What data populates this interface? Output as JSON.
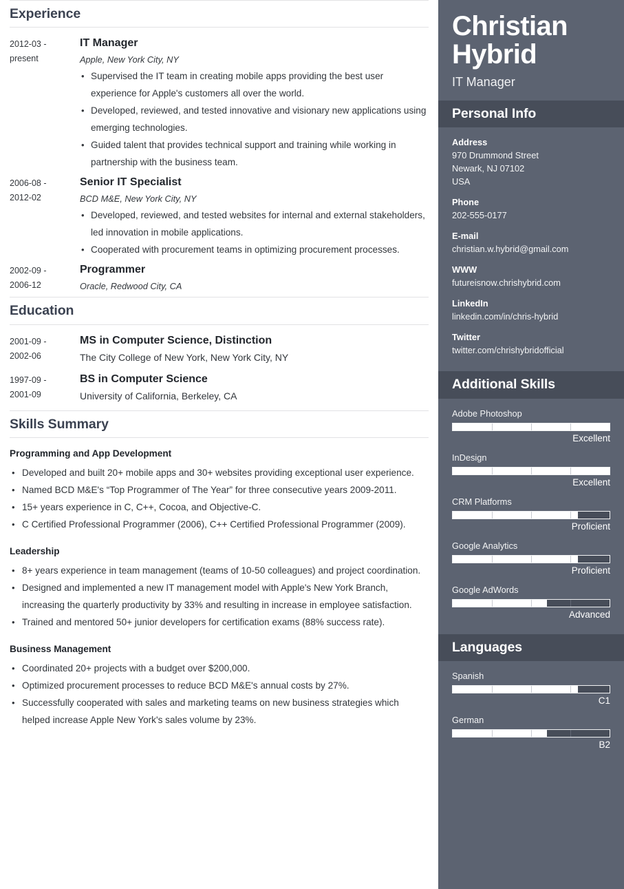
{
  "colors": {
    "sidebar_bg": "#5c6371",
    "sidebar_head_bg": "#474d59",
    "heading_text": "#3b4251",
    "body_text": "#33373c",
    "rule": "#e2e2e4"
  },
  "main": {
    "sections": [
      {
        "id": "experience",
        "title": "Experience",
        "entries": [
          {
            "dates": [
              "2012-03 -",
              "present"
            ],
            "title": "IT Manager",
            "subtitle": "Apple, New York City, NY",
            "bullets": [
              "Supervised the IT team in creating mobile apps providing the best user experience for Apple's customers all over the world.",
              "Developed, reviewed, and tested innovative and visionary new applications using emerging technologies.",
              "Guided talent that provides technical support and training while working in partnership with the business team."
            ]
          },
          {
            "dates": [
              "2006-08 -",
              "2012-02"
            ],
            "title": "Senior IT Specialist",
            "subtitle": "BCD M&E, New York City, NY",
            "bullets": [
              "Developed, reviewed, and tested websites for internal and external stakeholders, led innovation in mobile applications.",
              "Cooperated with procurement teams in optimizing procurement processes."
            ]
          },
          {
            "dates": [
              "2002-09 -",
              "2006-12"
            ],
            "title": "Programmer",
            "subtitle": "Oracle, Redwood City, CA",
            "bullets": []
          }
        ]
      },
      {
        "id": "education",
        "title": "Education",
        "entries": [
          {
            "dates": [
              "2001-09 -",
              "2002-06"
            ],
            "title": "MS in Computer Science, Distinction",
            "school": "The City College of New York, New York City, NY"
          },
          {
            "dates": [
              "1997-09 -",
              "2001-09"
            ],
            "title": "BS in Computer Science",
            "school": "University of California, Berkeley, CA"
          }
        ]
      },
      {
        "id": "skills-summary",
        "title": "Skills Summary",
        "groups": [
          {
            "heading": "Programming and App Development",
            "bullets": [
              "Developed and built 20+ mobile apps and 30+ websites providing exceptional user experience.",
              "Named BCD M&E's “Top Programmer of The Year” for three consecutive years 2009-2011.",
              "15+ years experience in C, C++, Cocoa, and Objective-C.",
              "C Certified Professional Programmer (2006), C++ Certified Professional Programmer (2009)."
            ]
          },
          {
            "heading": "Leadership",
            "bullets": [
              "8+ years experience in team management (teams of 10-50 colleagues) and project coordination.",
              "Designed and implemented a new IT management model with Apple's New York Branch, increasing the quarterly productivity by 33% and resulting in increase in employee satisfaction.",
              "Trained and mentored 50+ junior developers for certification exams (88% success rate)."
            ]
          },
          {
            "heading": "Business Management",
            "bullets": [
              "Coordinated 20+ projects with a budget over $200,000.",
              "Optimized procurement processes to reduce BCD M&E's annual costs by 27%.",
              "Successfully cooperated with sales and marketing teams on new business strategies which helped increase Apple New York's sales volume by 23%."
            ]
          }
        ]
      }
    ]
  },
  "sidebar": {
    "name_line1": "Christian",
    "name_line2": "Hybrid",
    "role": "IT Manager",
    "personal_info": {
      "title": "Personal Info",
      "items": [
        {
          "label": "Address",
          "values": [
            "970 Drummond Street",
            "Newark, NJ 07102",
            "USA"
          ]
        },
        {
          "label": "Phone",
          "values": [
            "202-555-0177"
          ]
        },
        {
          "label": "E-mail",
          "values": [
            "christian.w.hybrid@gmail.com"
          ]
        },
        {
          "label": "WWW",
          "values": [
            "futureisnow.chrishybrid.com"
          ]
        },
        {
          "label": "LinkedIn",
          "values": [
            "linkedin.com/in/chris-hybrid"
          ]
        },
        {
          "label": "Twitter",
          "values": [
            "twitter.com/chrishybridofficial"
          ]
        }
      ]
    },
    "additional_skills": {
      "title": "Additional Skills",
      "items": [
        {
          "name": "Adobe Photoshop",
          "level": "Excellent",
          "percent": 100
        },
        {
          "name": "InDesign",
          "level": "Excellent",
          "percent": 100
        },
        {
          "name": "CRM Platforms",
          "level": "Proficient",
          "percent": 80
        },
        {
          "name": "Google Analytics",
          "level": "Proficient",
          "percent": 80
        },
        {
          "name": "Google AdWords",
          "level": "Advanced",
          "percent": 60
        }
      ]
    },
    "languages": {
      "title": "Languages",
      "items": [
        {
          "name": "Spanish",
          "level": "C1",
          "percent": 80
        },
        {
          "name": "German",
          "level": "B2",
          "percent": 60
        }
      ]
    }
  }
}
